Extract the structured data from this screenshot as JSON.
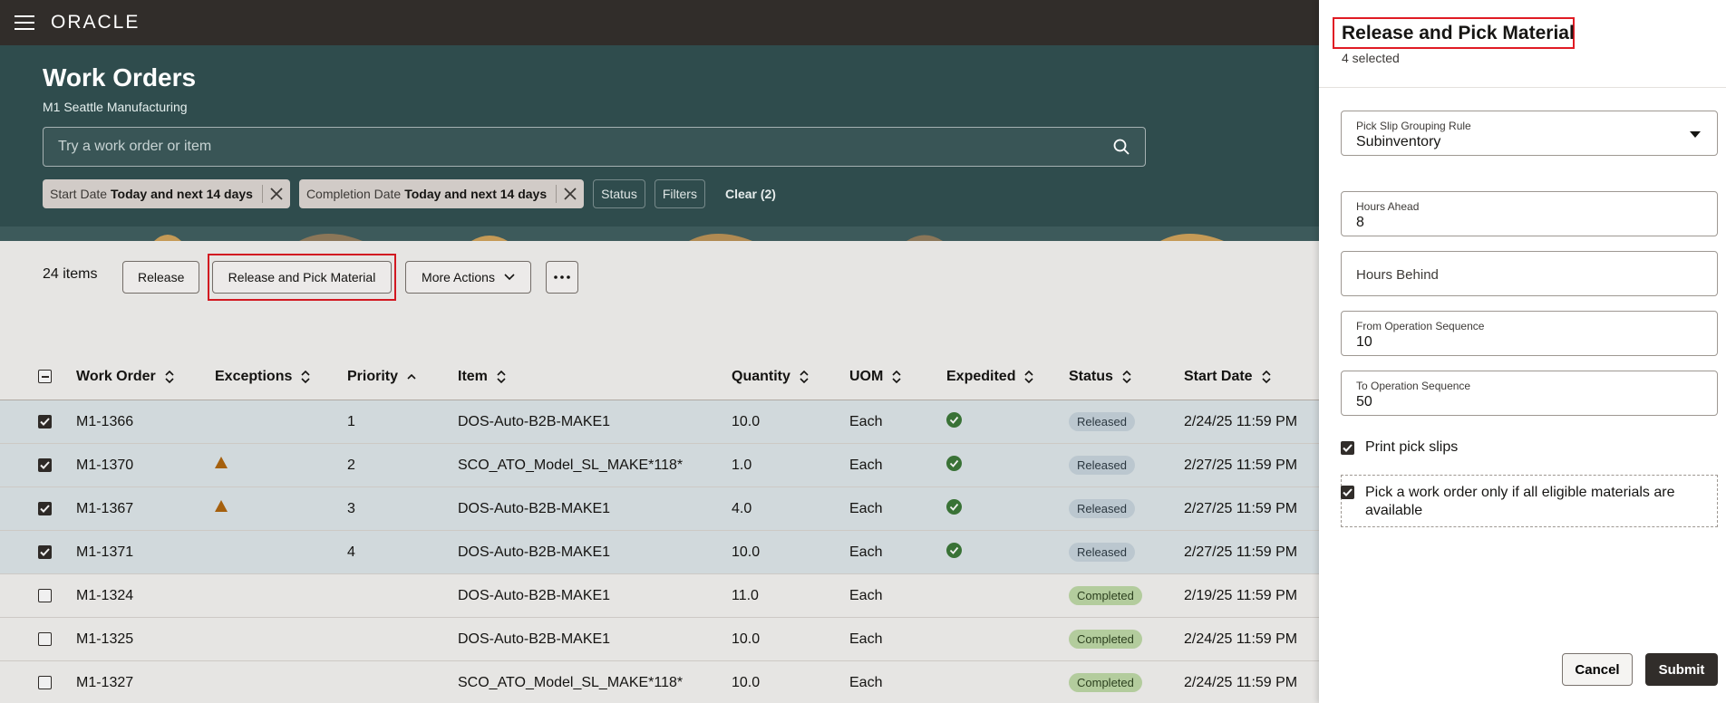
{
  "topbar": {
    "logo": "ORACLE"
  },
  "header": {
    "title": "Work Orders",
    "subtitle": "M1 Seattle Manufacturing",
    "search_placeholder": "Try a work order or item",
    "chips": [
      {
        "label": "Start Date",
        "value": "Today and next 14 days"
      },
      {
        "label": "Completion Date",
        "value": "Today and next 14 days"
      }
    ],
    "status_label": "Status",
    "filters_label": "Filters",
    "clear_label": "Clear (2)"
  },
  "toolbar": {
    "count": "24 items",
    "release": "Release",
    "release_pick": "Release and Pick Material",
    "more_actions": "More Actions"
  },
  "table": {
    "columns": [
      "Work Order",
      "Exceptions",
      "Priority",
      "Item",
      "Quantity",
      "UOM",
      "Expedited",
      "Status",
      "Start Date"
    ],
    "rows": [
      {
        "wo": "M1-1366",
        "exc": false,
        "priority": "1",
        "item": "DOS-Auto-B2B-MAKE1",
        "qty": "10.0",
        "uom": "Each",
        "exp": true,
        "status": "Released",
        "start": "2/24/25 11:59 PM",
        "selected": true
      },
      {
        "wo": "M1-1370",
        "exc": true,
        "priority": "2",
        "item": "SCO_ATO_Model_SL_MAKE*118*",
        "qty": "1.0",
        "uom": "Each",
        "exp": true,
        "status": "Released",
        "start": "2/27/25 11:59 PM",
        "selected": true
      },
      {
        "wo": "M1-1367",
        "exc": true,
        "priority": "3",
        "item": "DOS-Auto-B2B-MAKE1",
        "qty": "4.0",
        "uom": "Each",
        "exp": true,
        "status": "Released",
        "start": "2/27/25 11:59 PM",
        "selected": true
      },
      {
        "wo": "M1-1371",
        "exc": false,
        "priority": "4",
        "item": "DOS-Auto-B2B-MAKE1",
        "qty": "10.0",
        "uom": "Each",
        "exp": true,
        "status": "Released",
        "start": "2/27/25 11:59 PM",
        "selected": true
      },
      {
        "wo": "M1-1324",
        "exc": false,
        "priority": "",
        "item": "DOS-Auto-B2B-MAKE1",
        "qty": "11.0",
        "uom": "Each",
        "exp": false,
        "status": "Completed",
        "start": "2/19/25 11:59 PM",
        "selected": false
      },
      {
        "wo": "M1-1325",
        "exc": false,
        "priority": "",
        "item": "DOS-Auto-B2B-MAKE1",
        "qty": "10.0",
        "uom": "Each",
        "exp": false,
        "status": "Completed",
        "start": "2/24/25 11:59 PM",
        "selected": false
      },
      {
        "wo": "M1-1327",
        "exc": false,
        "priority": "",
        "item": "SCO_ATO_Model_SL_MAKE*118*",
        "qty": "10.0",
        "uom": "Each",
        "exp": false,
        "status": "Completed",
        "start": "2/24/25 11:59 PM",
        "selected": false
      }
    ]
  },
  "drawer": {
    "title": "Release and Pick Material",
    "subtitle": "4 selected",
    "grouping_label": "Pick Slip Grouping Rule",
    "grouping_value": "Subinventory",
    "hours_ahead_label": "Hours Ahead",
    "hours_ahead_value": "8",
    "hours_behind_label": "Hours Behind",
    "from_op_label": "From Operation Sequence",
    "from_op_value": "10",
    "to_op_label": "To Operation Sequence",
    "to_op_value": "50",
    "print_label": "Print pick slips",
    "pick_label": "Pick a work order only if all eligible materials are available",
    "cancel": "Cancel",
    "submit": "Submit"
  },
  "colors": {
    "brand_dark": "#312d2a",
    "header_teal": "#2f4c4d",
    "highlight_red": "#e01b24",
    "success_green": "#3d7a3a",
    "warning_orange": "#b0670f"
  }
}
